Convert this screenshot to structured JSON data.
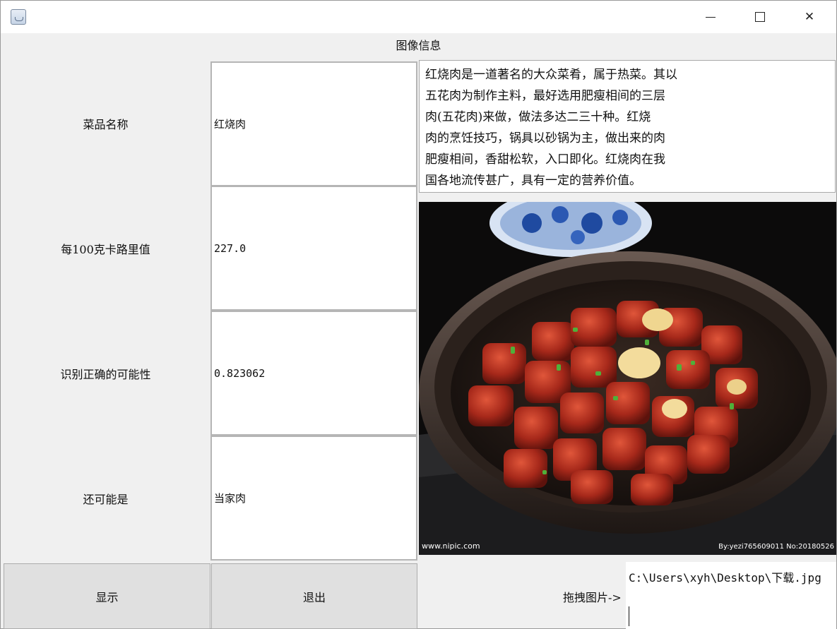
{
  "window": {
    "controls": {
      "minimize": "minimize",
      "maximize": "maximize",
      "close": "✕"
    }
  },
  "panel_title": "图像信息",
  "fields": [
    {
      "label": "菜品名称",
      "value": "红烧肉"
    },
    {
      "label": "每100克卡路里值",
      "value": "227.0"
    },
    {
      "label": "识别正确的可能性",
      "value": "0.823062"
    },
    {
      "label": "还可能是",
      "value": "当家肉"
    }
  ],
  "description": [
    "红烧肉是一道著名的大众菜肴，属于热菜。其以",
    "五花肉为制作主料，最好选用肥瘦相间的三层",
    "肉(五花肉)来做，做法多达二三十种。红烧",
    "肉的烹饪技巧，锅具以砂锅为主，做出来的肉",
    "肥瘦相间，香甜松软，入口即化。红烧肉在我",
    "国各地流传甚广，具有一定的营养价值。"
  ],
  "image": {
    "watermark_left": "www.nipic.com",
    "watermark_right": "By:yezi765609011 No:20180526"
  },
  "buttons": {
    "show": "显示",
    "exit": "退出"
  },
  "drag": {
    "label": "拖拽图片->",
    "path": "C:\\Users\\xyh\\Desktop\\下载.jpg"
  }
}
